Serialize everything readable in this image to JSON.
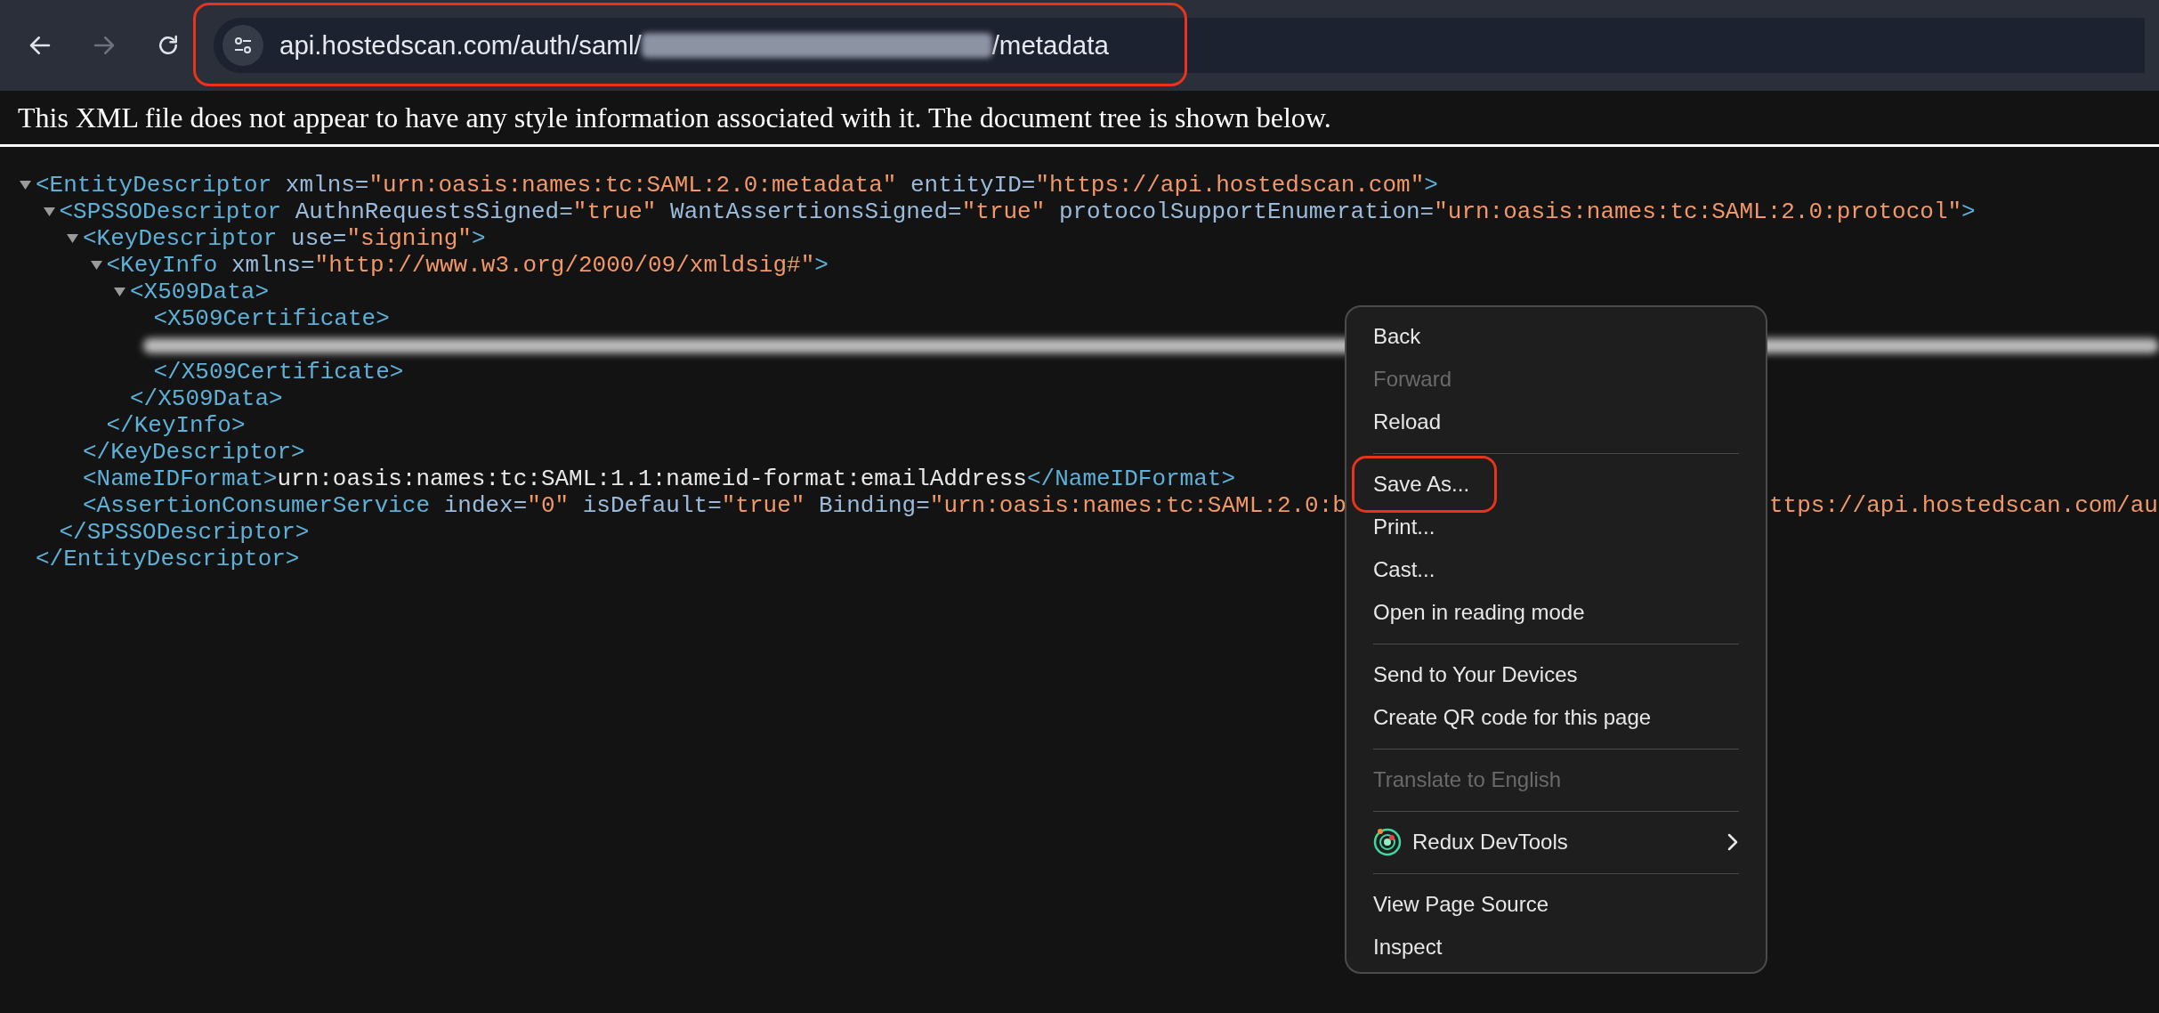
{
  "toolbar": {
    "nav_buttons": [
      {
        "kind": "back",
        "disabled": false
      },
      {
        "kind": "forward",
        "disabled": true
      },
      {
        "kind": "reload",
        "disabled": false
      }
    ],
    "address_bar": {
      "url_parts": [
        "api.hostedscan.com/auth/saml/",
        "/metadata"
      ],
      "redacted": true,
      "highlighted": true
    }
  },
  "message": "This XML file does not appear to have any style information associated with it. The document tree is shown below.",
  "xml_tree": [
    {
      "kind": "element",
      "open": "<EntityDescriptor xmlns=\"urn:oasis:names:tc:SAML:2.0:metadata\" entityID=\"https://api.hostedscan.com\">",
      "expanded": true,
      "close": "</EntityDescriptor>",
      "children": [
        {
          "kind": "element",
          "open": "<SPSSODescriptor AuthnRequestsSigned=\"true\" WantAssertionsSigned=\"true\" protocolSupportEnumeration=\"urn:oasis:names:tc:SAML:2.0:protocol\">",
          "expanded": true,
          "close": "</SPSSODescriptor>",
          "children": [
            {
              "kind": "element",
              "open": "<KeyDescriptor use=\"signing\">",
              "expanded": true,
              "close": "</KeyDescriptor>",
              "children": [
                {
                  "kind": "element",
                  "open": "<KeyInfo xmlns=\"http://www.w3.org/2000/09/xmldsig#\">",
                  "expanded": true,
                  "close": "</KeyInfo>",
                  "children": [
                    {
                      "kind": "element",
                      "open": "<X509Data>",
                      "expanded": true,
                      "close": "</X509Data>",
                      "children": [
                        {
                          "kind": "redacted",
                          "open": "<X509Certificate>",
                          "close": "</X509Certificate>"
                        }
                      ]
                    }
                  ]
                }
              ]
            },
            {
              "kind": "line",
              "text": "<NameIDFormat>urn:oasis:names:tc:SAML:1.1:nameid-format:emailAddress</NameIDFormat>"
            },
            {
              "kind": "line",
              "text": "<AssertionConsumerService index=\"0\" isDefault=\"true\" Binding=\"urn:oasis:names:tc:SAML:2.0:b",
              "continued": "ttps://api.hostedscan.com/au"
            }
          ]
        }
      ]
    }
  ],
  "context_menu": {
    "groups": [
      [
        {
          "label": "Back",
          "disabled": false,
          "highlighted": false
        },
        {
          "label": "Forward",
          "disabled": true,
          "highlighted": false
        },
        {
          "label": "Reload",
          "disabled": false,
          "highlighted": false
        }
      ],
      [
        {
          "label": "Save As...",
          "disabled": false,
          "highlighted": true
        },
        {
          "label": "Print...",
          "disabled": false,
          "highlighted": false
        },
        {
          "label": "Cast...",
          "disabled": false,
          "highlighted": false
        },
        {
          "label": "Open in reading mode",
          "disabled": false,
          "highlighted": false
        }
      ],
      [
        {
          "label": "Send to Your Devices",
          "disabled": false,
          "highlighted": false
        },
        {
          "label": "Create QR code for this page",
          "disabled": false,
          "highlighted": false
        }
      ],
      [
        {
          "label": "Translate to English",
          "disabled": true,
          "highlighted": false
        }
      ],
      [
        {
          "label": "Redux DevTools",
          "disabled": false,
          "highlighted": false,
          "kind": "extension",
          "submenu": true
        }
      ],
      [
        {
          "label": "View Page Source",
          "disabled": false,
          "highlighted": false
        },
        {
          "label": "Inspect",
          "disabled": false,
          "highlighted": false
        }
      ]
    ]
  }
}
